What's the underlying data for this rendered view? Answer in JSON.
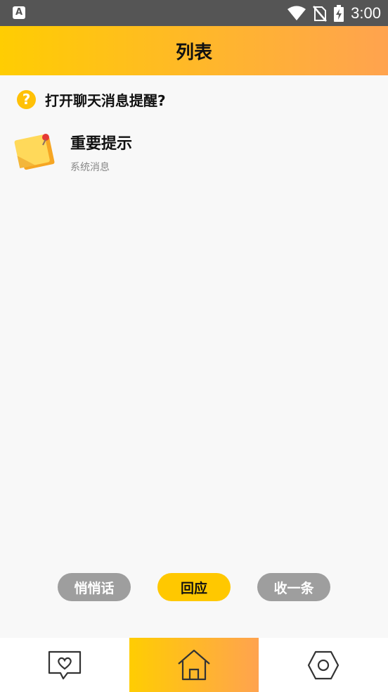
{
  "status_bar": {
    "time": "3:00",
    "app_icon_glyph": "A",
    "icons": [
      "wifi-icon",
      "no-sim-icon",
      "battery-charging-icon"
    ]
  },
  "header": {
    "title": "列表"
  },
  "prompt": {
    "icon": "help-icon",
    "text": "打开聊天消息提醒?"
  },
  "messages": [
    {
      "icon": "sticky-note-icon",
      "title": "重要提示",
      "subtitle": "系统消息"
    }
  ],
  "actions": {
    "whisper": "悄悄话",
    "reply": "回应",
    "collect": "收一条"
  },
  "tabbar": {
    "tabs": [
      {
        "icon": "chat-heart-icon",
        "active": false
      },
      {
        "icon": "home-icon",
        "active": true
      },
      {
        "icon": "settings-icon",
        "active": false
      }
    ]
  },
  "colors": {
    "accent_start": "#ffcd02",
    "accent_end": "#ffa34f",
    "pill_gray": "#9e9e9e",
    "pill_yellow": "#ffc800"
  }
}
